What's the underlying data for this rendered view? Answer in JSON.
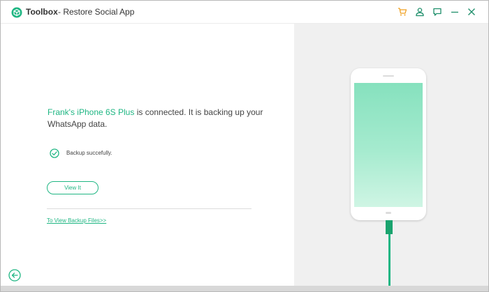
{
  "titlebar": {
    "brand": "Toolbox",
    "title": "- Restore Social App",
    "icons": [
      "cart-icon",
      "user-icon",
      "feedback-icon",
      "minimize-icon",
      "close-icon"
    ]
  },
  "main": {
    "device_name": "Frank's iPhone 6S Plus",
    "status_text": " is connected. It is backing up your WhatsApp data.",
    "backup_status": "Backup succefully.",
    "view_button_label": "View It",
    "backup_link": "To View Backup Files>>"
  },
  "colors": {
    "accent": "#1fb683",
    "cart_icon": "#f0a020",
    "icon_gray": "#1f8f6b",
    "right_panel": "#f0f0f0"
  }
}
